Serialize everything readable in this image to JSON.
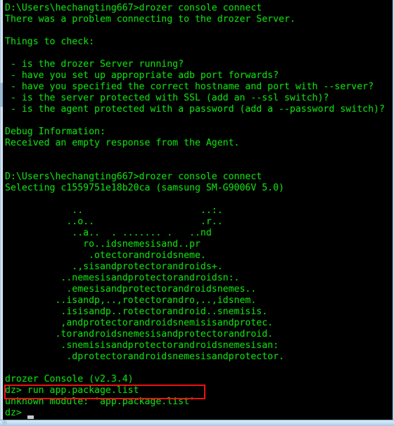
{
  "window": {
    "kind": "windows-console",
    "background_color": "#000000",
    "text_color": "#13d313",
    "chrome_color": "#c8dcf0",
    "highlight_color": "#ee1111",
    "cursor_color": "#c9c9c9"
  },
  "terminal": {
    "lines": [
      "D:\\Users\\hechangting667>drozer console connect",
      "There was a problem connecting to the drozer Server.",
      "",
      "Things to check:",
      "",
      " - is the drozer Server running?",
      " - have you set up appropriate adb port forwards?",
      " - have you specified the correct hostname and port with --server?",
      " - is the server protected with SSL (add an --ssl switch)?",
      " - is the agent protected with a password (add a --password switch)?",
      "",
      "Debug Information:",
      "Received an empty response from the Agent.",
      "",
      "",
      "D:\\Users\\hechangting667>drozer console connect",
      "Selecting c1559751e18b20ca (samsung SM-G9006V 5.0)",
      "",
      "            ..                     ..:.",
      "           ..o..                   .r..",
      "            ..a..  . ....... .   ..nd",
      "              ro..idsnemesisand..pr",
      "               .otectorandroidsneme.",
      "            .,sisandprotectorandroids+.",
      "          ..nemesisandprotectorandroidsn:.",
      "           .emesisandprotectorandroidsnemes..",
      "         ..isandp,..,rotectorandro,..,idsnem.",
      "          .isisandp..rotectorandroid..snemisis.",
      "          ,andprotectorandroidsnemisisandprotec.",
      "         .torandroidsnemesisandprotectorandroid.",
      "          .snemisisandprotectorandroidsnemesisan:",
      "           .dprotectorandroidsnemesisandprotector.",
      "",
      "drozer Console (v2.3.4)",
      "dz> run app.package.list",
      "unknown module: 'app.package.list'",
      "dz> "
    ],
    "error_line_index": 34,
    "error_text": "unknown module: 'app.package.list'",
    "prompt_symbol": "dz>",
    "command_entered": "run app.package.list",
    "version_banner": "drozer Console (v2.3.4)",
    "device_id": "c1559751e18b20ca",
    "device_name": "samsung SM-G9006V 5.0",
    "shell_prompt": "D:\\Users\\hechangting667>",
    "shell_command": "drozer console connect"
  }
}
